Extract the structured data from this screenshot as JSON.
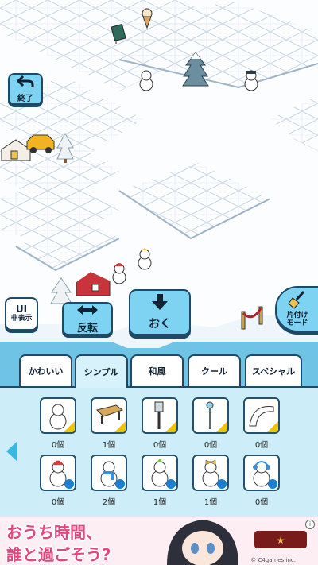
{
  "controls": {
    "exit_label": "終了",
    "ui_label_1": "UI",
    "ui_label_2": "非表示",
    "flip_label": "反転",
    "place_label": "おく",
    "tidy_label_1": "片付け",
    "tidy_label_2": "モード"
  },
  "tabs": [
    {
      "label": "かわいい",
      "active": false
    },
    {
      "label": "シンプル",
      "active": true
    },
    {
      "label": "和風",
      "active": false
    },
    {
      "label": "クール",
      "active": false
    },
    {
      "label": "スペシャル",
      "active": false
    }
  ],
  "items_row1": [
    {
      "icon": "snowman-icon",
      "count": "0個"
    },
    {
      "icon": "bench-icon",
      "count": "1個"
    },
    {
      "icon": "street-lamp-icon",
      "count": "0個"
    },
    {
      "icon": "lamp-post-icon",
      "count": "0個"
    },
    {
      "icon": "snow-arch-icon",
      "count": "0個"
    }
  ],
  "items_row2": [
    {
      "icon": "snowman-red-hat-icon",
      "count": "0個"
    },
    {
      "icon": "snowman-scarf-icon",
      "count": "2個"
    },
    {
      "icon": "snowman-leaf-icon",
      "count": "1個"
    },
    {
      "icon": "snowman-bow-icon",
      "count": "1個"
    },
    {
      "icon": "snowman-earmuffs-icon",
      "count": "0個"
    }
  ],
  "ad": {
    "line1": "おうち時間、",
    "line2": "誰と過ごそう?",
    "copyright": "© C4games inc.",
    "info": "i"
  },
  "colors": {
    "button": "#7fd3f2",
    "outline": "#1d4a66",
    "panel": "#cdeef8",
    "tab_bar": "#6fc4e6",
    "ad_text": "#e4477f"
  }
}
